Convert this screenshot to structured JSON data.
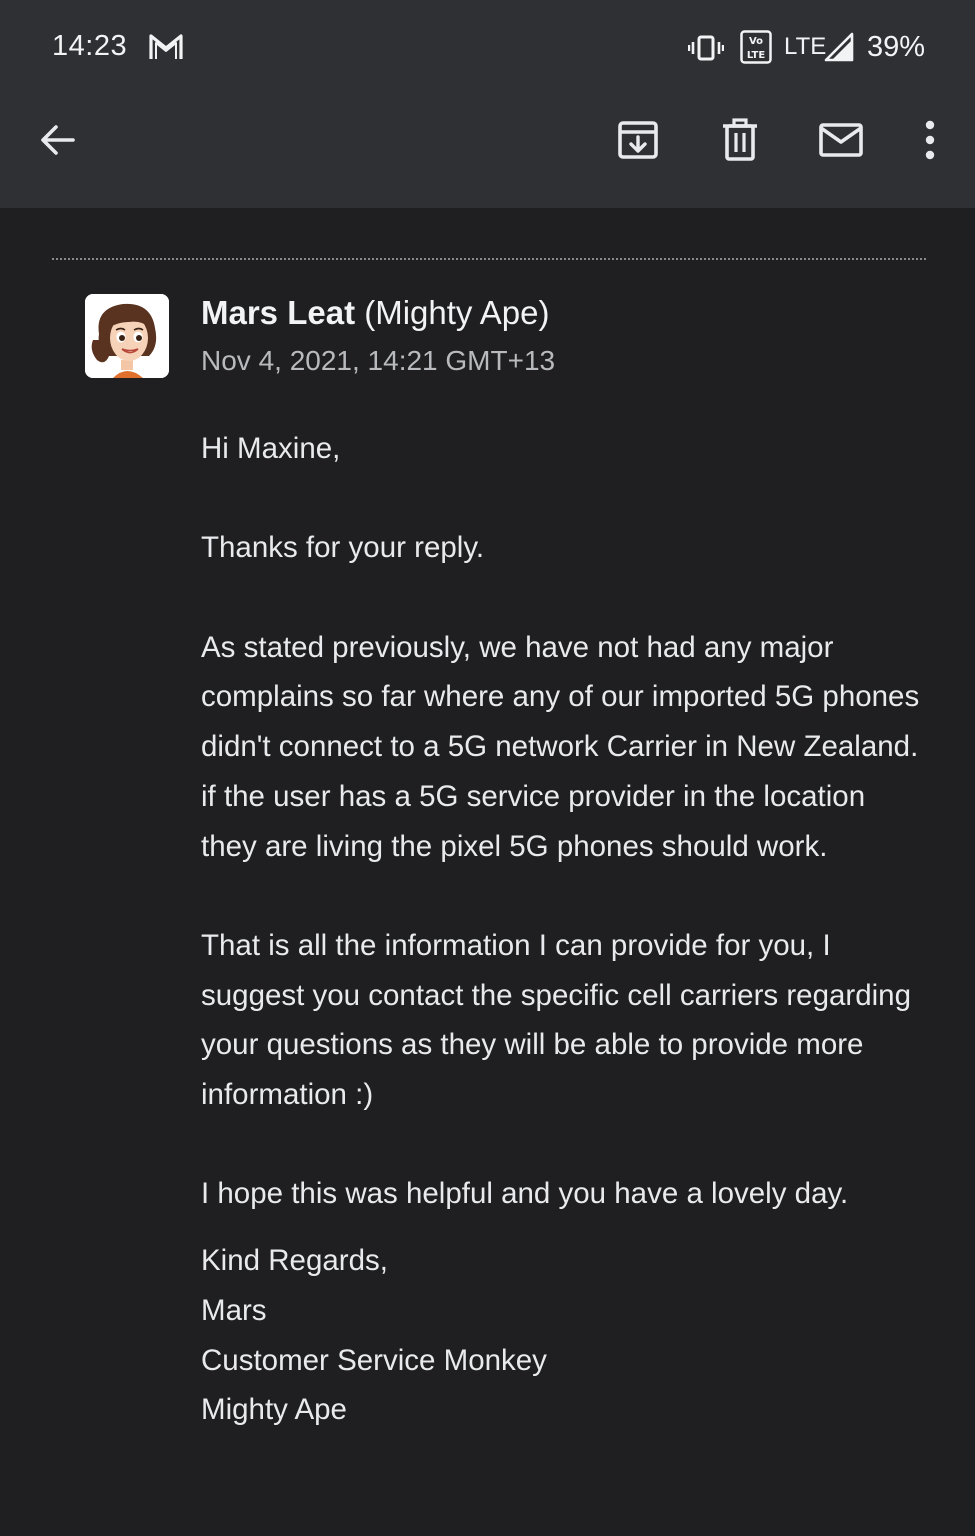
{
  "status_bar": {
    "time": "14:23",
    "network": "LTE",
    "battery": "39%"
  },
  "toolbar": {
    "icons": [
      "back-arrow-icon",
      "archive-icon",
      "delete-icon",
      "mark-unread-icon",
      "more-options-icon"
    ]
  },
  "email": {
    "sender_name": "Mars Leat",
    "sender_org": "(Mighty Ape)",
    "date": "Nov 4, 2021, 14:21 GMT+13",
    "body": [
      "Hi Maxine,",
      "Thanks for your reply.",
      "As stated previously, we have not had any major complains so far where any of our imported 5G phones didn't connect to a 5G network Carrier in New Zealand. if the user has a 5G service provider in the location they are living the pixel 5G phones should work.",
      "That is all the information I can provide for you, I suggest you contact the specific cell carriers regarding your questions as they will be able to provide more information :)",
      "I hope this was helpful and you have a lovely day."
    ],
    "signature": [
      "Kind Regards,",
      "Mars",
      "Customer Service Monkey",
      "Mighty Ape"
    ]
  },
  "colors": {
    "toolbar_bg": "#2f3034",
    "content_bg": "#1f1f21",
    "text": "#e8eaed",
    "secondary_text": "#b8babd"
  }
}
